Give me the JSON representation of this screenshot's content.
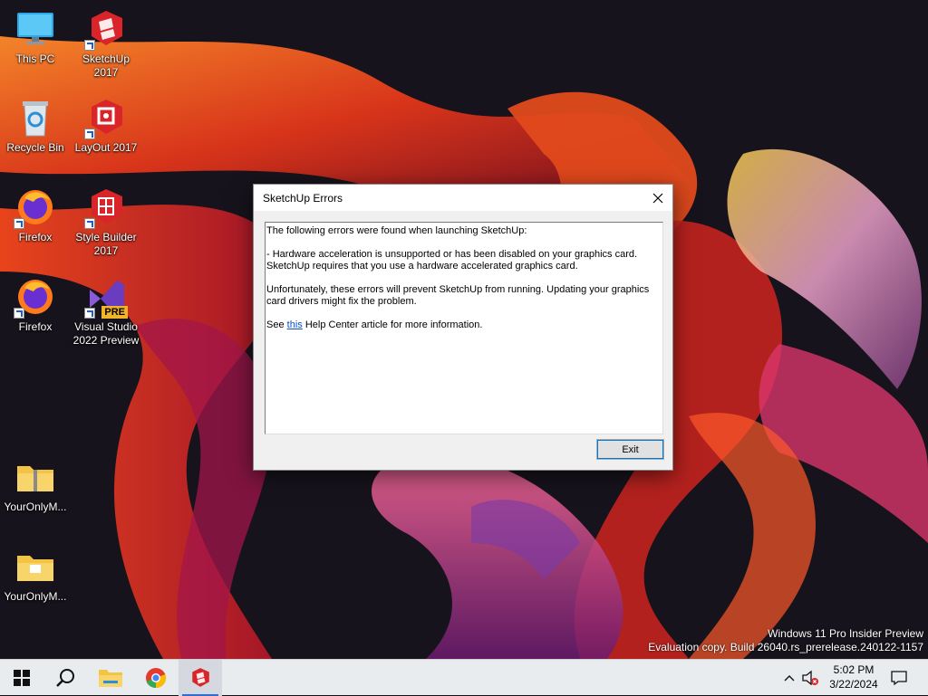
{
  "desktop": {
    "icons": [
      {
        "label": "This PC",
        "icon": "computer-icon"
      },
      {
        "label": "SketchUp 2017",
        "icon": "sketchup-icon"
      },
      {
        "label": "Recycle Bin",
        "icon": "recycle-bin-icon"
      },
      {
        "label": "LayOut 2017",
        "icon": "layout-icon"
      },
      {
        "label": "Firefox",
        "icon": "firefox-icon"
      },
      {
        "label": "Style Builder 2017",
        "icon": "style-builder-icon"
      },
      {
        "label": "Firefox",
        "icon": "firefox-icon"
      },
      {
        "label": "Visual Studio 2022 Preview",
        "icon": "visual-studio-icon",
        "badge": "PRE"
      },
      {
        "label": "YourOnlyM...",
        "icon": "zip-folder-icon"
      },
      {
        "label": "YourOnlyM...",
        "icon": "folder-icon"
      }
    ]
  },
  "dialog": {
    "title": "SketchUp Errors",
    "lines": [
      "The following errors were found when launching SketchUp:",
      "- Hardware acceleration is unsupported or has been disabled on your graphics card. SketchUp requires that you use a hardware accelerated graphics card.",
      "Unfortunately, these errors will prevent SketchUp from running. Updating your graphics card drivers might fix the problem."
    ],
    "see_prefix": "See ",
    "link_text": "this",
    "see_suffix": " Help Center article for more information.",
    "exit_label": "Exit"
  },
  "watermark": {
    "line1": "Windows 11 Pro Insider Preview",
    "line2": "Evaluation copy. Build 26040.rs_prerelease.240122-1157"
  },
  "taskbar": {
    "apps": [
      "start-icon",
      "search-icon",
      "file-explorer-icon",
      "chrome-icon",
      "sketchup-icon"
    ],
    "time": "5:02 PM",
    "date": "3/22/2024"
  },
  "colors": {
    "accent": "#0078d7",
    "link": "#0a50c8",
    "sketchup_red": "#d9252a"
  }
}
